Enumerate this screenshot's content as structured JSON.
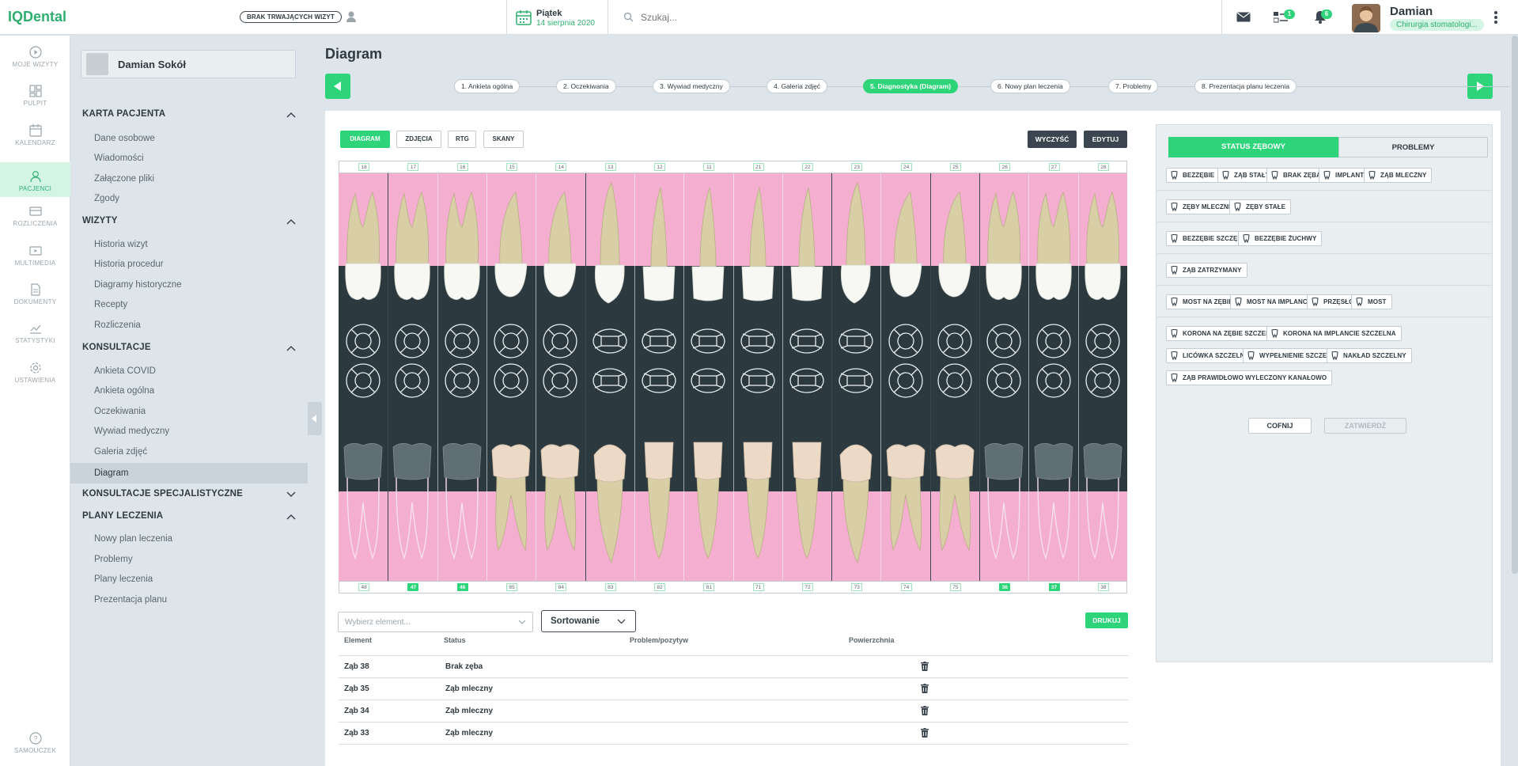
{
  "app": {
    "logo": "IQDental",
    "no_visit": "BRAK TRWAJĄCYCH WIZYT"
  },
  "date": {
    "day": "Piątek",
    "date": "14 sierpnia 2020"
  },
  "search": {
    "placeholder": "Szukaj..."
  },
  "topbar": {
    "tasks_badge": "1",
    "notif_badge": "6"
  },
  "user": {
    "name": "Damian",
    "role": "Chirurgia stomatologi..."
  },
  "iconbar": [
    {
      "label": "MOJE WIZYTY",
      "icon": "play-circle-icon"
    },
    {
      "label": "PULPIT",
      "icon": "dashboard-icon"
    },
    {
      "label": "KALENDARZ",
      "icon": "calendar-icon"
    },
    {
      "label": "PACJENCI",
      "icon": "user-icon"
    },
    {
      "label": "ROZLICZENIA",
      "icon": "card-icon"
    },
    {
      "label": "MULTIMEDIA",
      "icon": "video-icon"
    },
    {
      "label": "DOKUMENTY",
      "icon": "document-icon"
    },
    {
      "label": "STATYSTYKI",
      "icon": "chart-icon"
    },
    {
      "label": "USTAWIENIA",
      "icon": "gear-icon"
    },
    {
      "label": "SAMOUCZEK",
      "icon": "help-icon"
    }
  ],
  "patient": {
    "name": "Damian Sokół"
  },
  "menu": {
    "karta": {
      "title": "KARTA PACJENTA",
      "items": [
        "Dane osobowe",
        "Wiadomości",
        "Załączone pliki",
        "Zgody"
      ]
    },
    "wizyty": {
      "title": "WIZYTY",
      "items": [
        "Historia wizyt",
        "Historia procedur",
        "Diagramy historyczne",
        "Recepty",
        "Rozliczenia"
      ]
    },
    "konsultacje": {
      "title": "KONSULTACJE",
      "items": [
        "Ankieta COVID",
        "Ankieta ogólna",
        "Oczekiwania",
        "Wywiad medyczny",
        "Galeria zdjęć",
        "Diagram"
      ]
    },
    "specjal": {
      "title": "KONSULTACJE SPECJALISTYCZNE"
    },
    "plany": {
      "title": "PLANY LECZENIA",
      "items": [
        "Nowy plan leczenia",
        "Problemy",
        "Plany leczenia",
        "Prezentacja planu"
      ]
    }
  },
  "page": {
    "title": "Diagram"
  },
  "steps": [
    "1. Ankieta ogólna",
    "2. Oczekiwania",
    "3. Wywiad medyczny",
    "4. Galeria zdjęć",
    "5. Diagnostyka (Diagram)",
    "6. Nowy plan leczenia",
    "7. Problemy",
    "8. Prezentacja planu leczenia"
  ],
  "tabs": [
    "DIAGRAM",
    "ZDJĘCIA",
    "RTG",
    "SKANY"
  ],
  "actions": {
    "clear": "WYCZYŚĆ",
    "edit": "EDYTUJ",
    "print": "DRUKUJ"
  },
  "upper_numbers": [
    "18",
    "17",
    "16",
    "15",
    "14",
    "13",
    "12",
    "11",
    "21",
    "22",
    "23",
    "24",
    "25",
    "26",
    "27",
    "28"
  ],
  "lower_numbers": [
    "48",
    "47",
    "46",
    "85",
    "84",
    "83",
    "82",
    "81",
    "71",
    "72",
    "73",
    "74",
    "75",
    "36",
    "37",
    "38"
  ],
  "lower_highlight": [
    false,
    true,
    true,
    false,
    false,
    false,
    false,
    false,
    false,
    false,
    false,
    false,
    false,
    true,
    true,
    false
  ],
  "filters": {
    "select_placeholder": "Wybierz element...",
    "sort_label": "Sortowanie"
  },
  "table": {
    "headers": [
      "Element",
      "Status",
      "Problem/pozytyw",
      "Powierzchnia"
    ],
    "rows": [
      {
        "element": "Ząb 38",
        "status": "Brak zęba"
      },
      {
        "element": "Ząb 35",
        "status": "Ząb mleczny"
      },
      {
        "element": "Ząb 34",
        "status": "Ząb mleczny"
      },
      {
        "element": "Ząb 33",
        "status": "Ząb mleczny"
      }
    ]
  },
  "right_tabs": [
    "STATUS ZĘBOWY",
    "PROBLEMY"
  ],
  "chips": {
    "g1": [
      "BEZZĘBIE",
      "ZĄB STAŁY",
      "BRAK ZĘBA",
      "IMPLANT",
      "ZĄB MLECZNY"
    ],
    "g2": [
      "ZĘBY MLECZNE",
      "ZĘBY STAŁE"
    ],
    "g3": [
      "BEZZĘBIE SZCZĘKI",
      "BEZZĘBIE ŻUCHWY"
    ],
    "g4": [
      "ZĄB ZATRZYMANY"
    ],
    "g5": [
      "MOST NA ZĘBIE",
      "MOST NA IMPLANCIE",
      "PRZĘSŁO",
      "MOST"
    ],
    "g6": [
      "KORONA NA ZĘBIE SZCZELNA",
      "KORONA NA IMPLANCIE SZCZELNA",
      "LICÓWKA SZCZELNA",
      "WYPEŁNIENIE SZCZELNE",
      "NAKŁAD SZCZELNY",
      "ZĄB PRAWIDŁOWO WYLECZONY KANAŁOWO"
    ]
  },
  "right_actions": {
    "back": "COFNIJ",
    "confirm": "ZATWIERDŹ"
  },
  "colors": {
    "accent": "#2ed47a",
    "dark": "#3c4650",
    "gum": "#f4aecf"
  }
}
